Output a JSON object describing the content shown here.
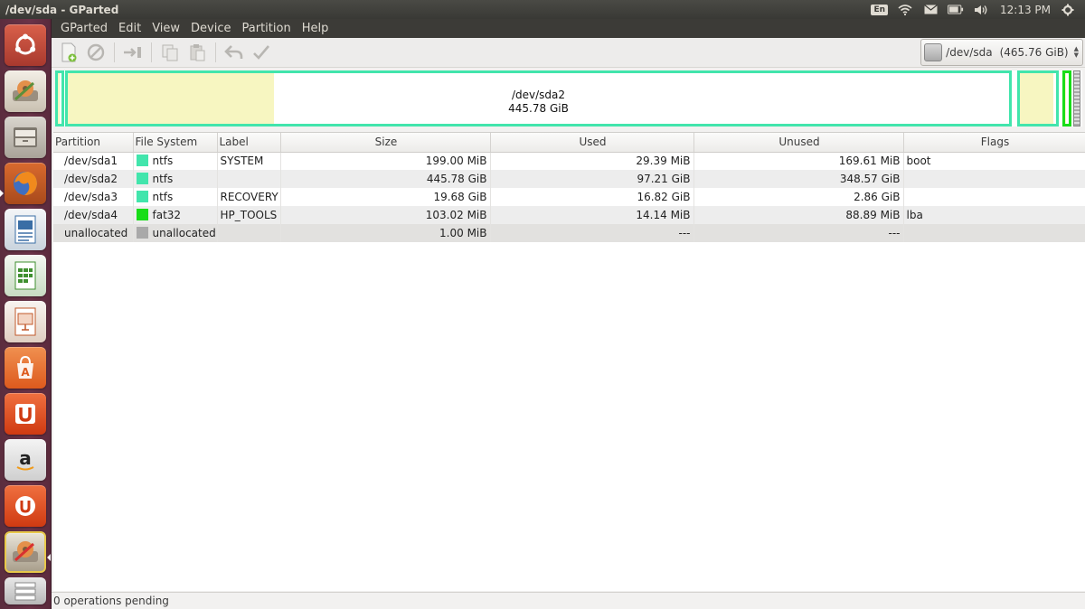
{
  "top_panel": {
    "title": "/dev/sda - GParted",
    "keyboard": "En",
    "time": "12:13 PM"
  },
  "menu": [
    "GParted",
    "Edit",
    "View",
    "Device",
    "Partition",
    "Help"
  ],
  "toolbar": {
    "icons": [
      "new-icon",
      "delete-icon",
      "resize-move-icon",
      "copy-icon",
      "paste-icon",
      "undo-icon",
      "apply-icon"
    ]
  },
  "device": {
    "name": "/dev/sda",
    "size": "(465.76 GiB)"
  },
  "diskmap": {
    "selected_name": "/dev/sda2",
    "selected_size": "445.78 GiB"
  },
  "table": {
    "headers": [
      "Partition",
      "File System",
      "Label",
      "Size",
      "Used",
      "Unused",
      "Flags"
    ],
    "rows": [
      {
        "partition": "/dev/sda1",
        "fs": "ntfs",
        "fs_color": "#42e5ac",
        "label": "SYSTEM",
        "size": "199.00 MiB",
        "used": "29.39 MiB",
        "unused": "169.61 MiB",
        "flags": "boot"
      },
      {
        "partition": "/dev/sda2",
        "fs": "ntfs",
        "fs_color": "#42e5ac",
        "label": "",
        "size": "445.78 GiB",
        "used": "97.21 GiB",
        "unused": "348.57 GiB",
        "flags": ""
      },
      {
        "partition": "/dev/sda3",
        "fs": "ntfs",
        "fs_color": "#42e5ac",
        "label": "RECOVERY",
        "size": "19.68 GiB",
        "used": "16.82 GiB",
        "unused": "2.86 GiB",
        "flags": ""
      },
      {
        "partition": "/dev/sda4",
        "fs": "fat32",
        "fs_color": "#18dd18",
        "label": "HP_TOOLS",
        "size": "103.02 MiB",
        "used": "14.14 MiB",
        "unused": "88.89 MiB",
        "flags": "lba"
      },
      {
        "partition": "unallocated",
        "fs": "unallocated",
        "fs_color": "#a9a9a9",
        "label": "",
        "size": "1.00 MiB",
        "used": "---",
        "unused": "---",
        "flags": ""
      }
    ]
  },
  "status": "0 operations pending",
  "colors": {
    "ntfs": "#42e5ac",
    "fat32": "#18dd18",
    "used_fill": "#f7f6c1",
    "launcher_bg": "#6b3348",
    "panel_bg": "#3c3b37"
  }
}
